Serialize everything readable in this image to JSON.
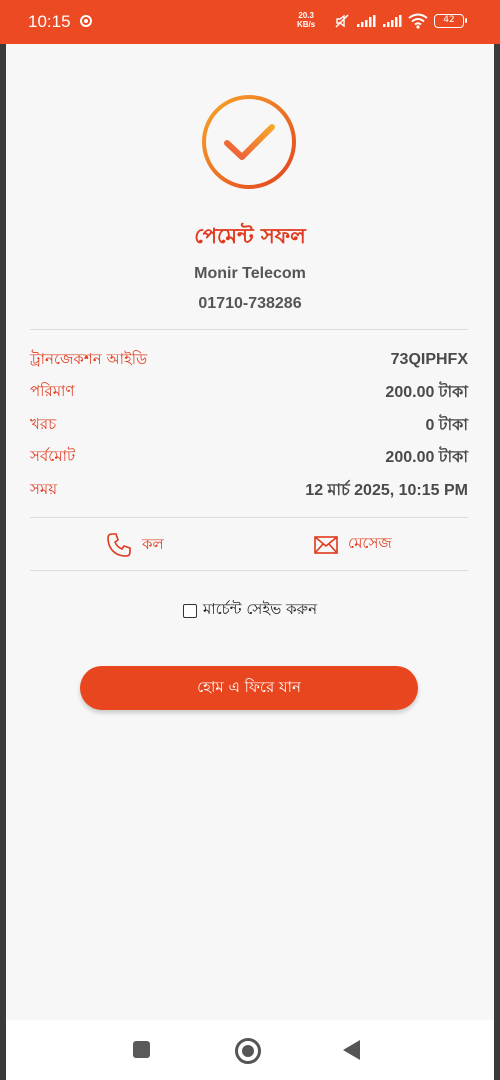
{
  "status_bar": {
    "time": "10:15",
    "net_speed_value": "20.3",
    "net_speed_unit": "KB/s",
    "battery": "42"
  },
  "receipt": {
    "title": "পেমেন্ট সফল",
    "merchant_name": "Monir Telecom",
    "merchant_phone": "01710-738286",
    "rows": [
      {
        "label": "ট্রানজেকশন আইডি",
        "value": "73QIPHFX"
      },
      {
        "label": "পরিমাণ",
        "value": "200.00 টাকা"
      },
      {
        "label": "খরচ",
        "value": "0 টাকা"
      },
      {
        "label": "সর্বমোট",
        "value": "200.00 টাকা"
      },
      {
        "label": "সময়",
        "value": "12 মার্চ 2025, 10:15 PM"
      }
    ],
    "call_label": "কল",
    "message_label": "মেসেজ",
    "save_merchant_label": "মার্চেন্ট সেইভ করুন",
    "home_button_label": "হোম এ ফিরে যান"
  },
  "colors": {
    "accent": "#ec4a23",
    "label_red": "#e0391d"
  },
  "icons": {
    "check": "check-circle-icon",
    "call": "phone-icon",
    "message": "envelope-icon",
    "nav_recent": "square-icon",
    "nav_home": "circle-icon",
    "nav_back": "back-triangle-icon"
  }
}
